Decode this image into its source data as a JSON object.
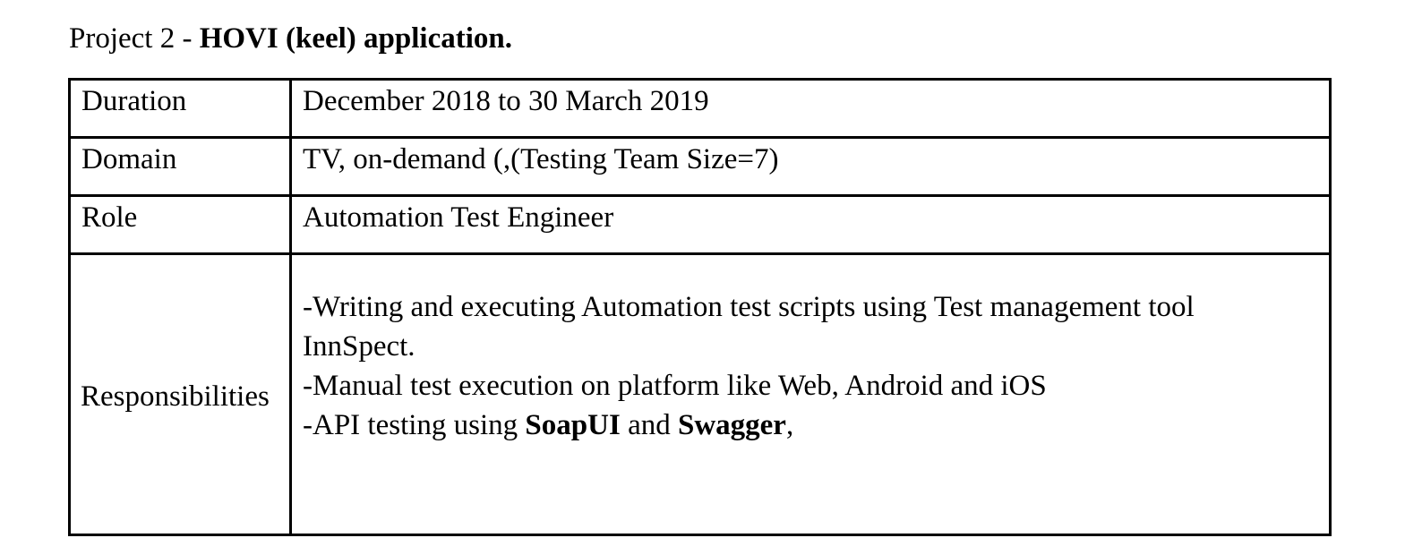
{
  "heading": {
    "prefix": "Project 2 - ",
    "title": "HOVI (keel) application."
  },
  "rows": [
    {
      "label": "Duration",
      "value": "December 2018 to 30 March 2019"
    },
    {
      "label": "Domain",
      "value": "TV, on-demand (,(Testing Team Size=7)"
    },
    {
      "label": "Role",
      "value": "Automation Test Engineer"
    }
  ],
  "responsibilities": {
    "label": "Responsibilities",
    "line1": "-Writing and executing Automation test scripts using Test management tool",
    "line2": "InnSpect.",
    "line3": "-Manual test execution on platform like Web, Android and iOS",
    "line4_prefix": "-API testing using ",
    "line4_tool1": "SoapUI",
    "line4_mid": " and ",
    "line4_tool2": "Swagger",
    "line4_suffix": ","
  }
}
